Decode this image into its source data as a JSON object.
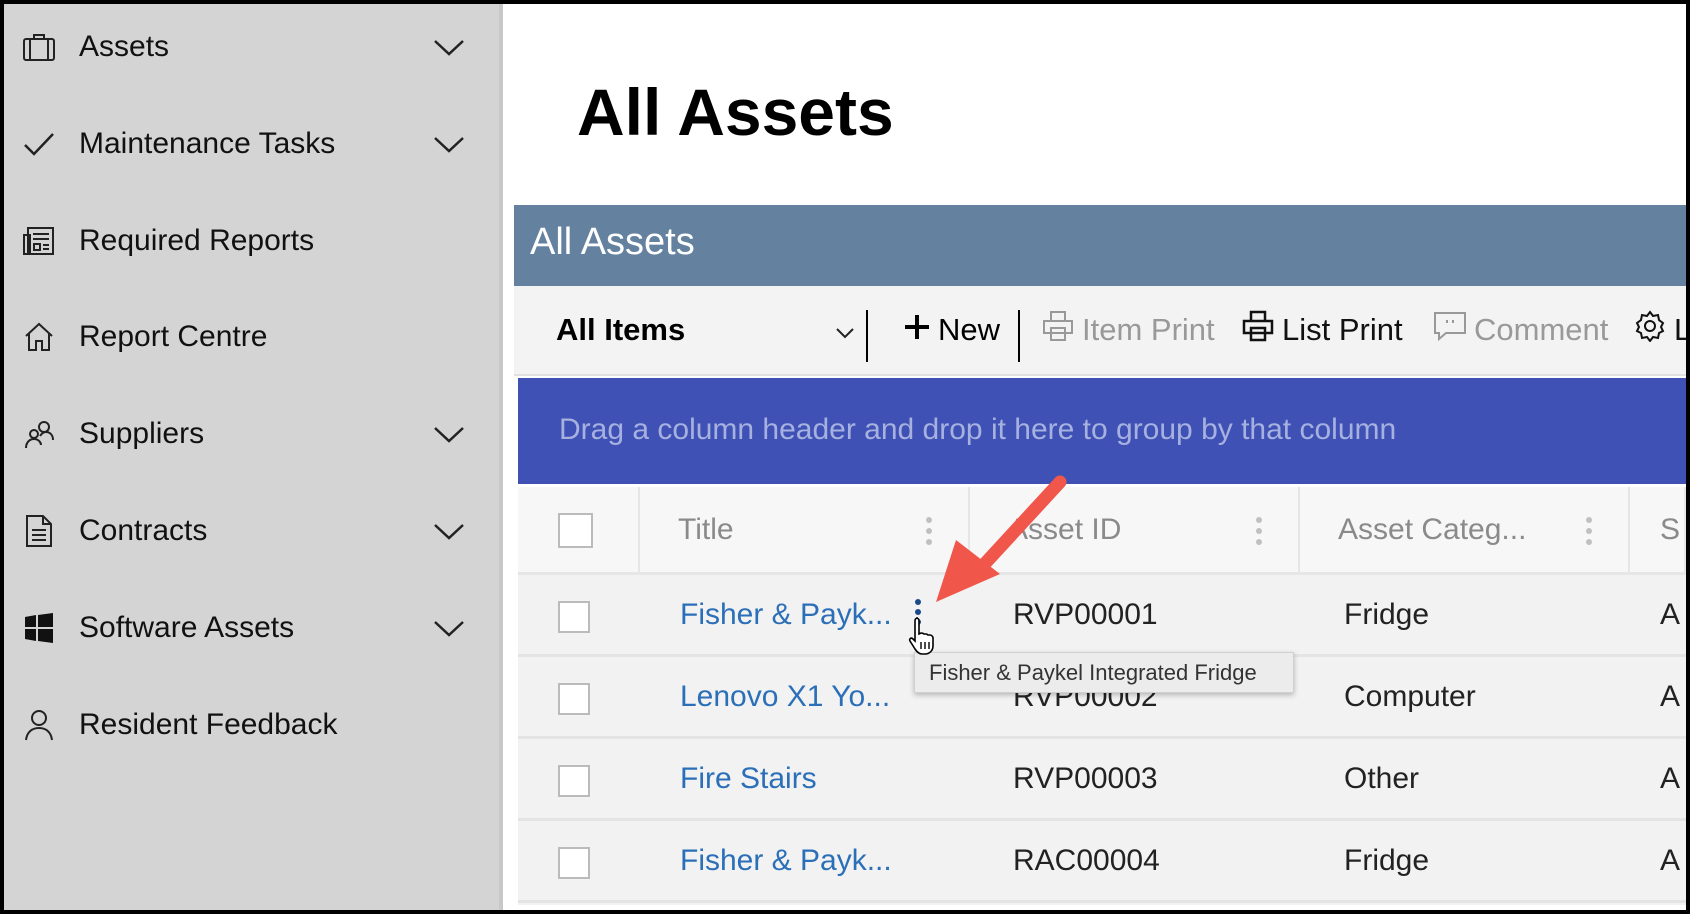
{
  "sidebar": {
    "items": [
      {
        "label": "Assets",
        "icon": "briefcase-icon",
        "expandable": true
      },
      {
        "label": "Maintenance Tasks",
        "icon": "checkmark-icon",
        "expandable": true
      },
      {
        "label": "Required Reports",
        "icon": "report-icon",
        "expandable": false
      },
      {
        "label": "Report Centre",
        "icon": "home-icon",
        "expandable": false
      },
      {
        "label": "Suppliers",
        "icon": "people-icon",
        "expandable": true
      },
      {
        "label": "Contracts",
        "icon": "document-icon",
        "expandable": true
      },
      {
        "label": "Software Assets",
        "icon": "windows-icon",
        "expandable": true
      },
      {
        "label": "Resident Feedback",
        "icon": "person-icon",
        "expandable": false
      }
    ]
  },
  "page": {
    "title": "All Assets"
  },
  "list": {
    "title": "All Assets",
    "toolbar": {
      "view": "All Items",
      "new": "New",
      "item_print": "Item Print",
      "list_print": "List Print",
      "comment": "Comment",
      "settings_partial": "L"
    },
    "group_hint": "Drag a column header and drop it here to group by that column",
    "columns": [
      "Title",
      "Asset ID",
      "Asset Categ...",
      "S"
    ],
    "rows": [
      {
        "title": "Fisher & Payk...",
        "id": "RVP00001",
        "category": "Fridge",
        "next": "A"
      },
      {
        "title": "Lenovo X1 Yo...",
        "id": "RVP00002",
        "category": "Computer",
        "next": "A"
      },
      {
        "title": "Fire Stairs",
        "id": "RVP00003",
        "category": "Other",
        "next": "A"
      },
      {
        "title": "Fisher & Payk...",
        "id": "RAC00004",
        "category": "Fridge",
        "next": "A"
      }
    ],
    "tooltip": "Fisher & Paykel Integrated Fridge"
  },
  "colors": {
    "header": "#6482a0",
    "groupbar": "#3f51b5",
    "link": "#2a6fb8",
    "arrow": "#f0574a"
  }
}
